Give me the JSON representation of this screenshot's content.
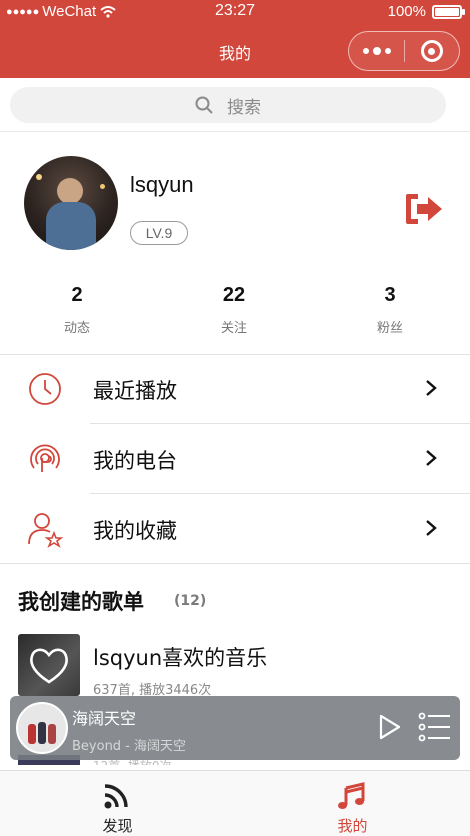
{
  "status_bar": {
    "carrier": "WeChat",
    "time": "23:27",
    "battery": "100%",
    "battery_level": 1.0
  },
  "nav": {
    "title": "我的"
  },
  "search": {
    "placeholder": "搜索"
  },
  "profile": {
    "username": "lsqyun",
    "level": "LV.9"
  },
  "stats": [
    {
      "value": "2",
      "label": "动态"
    },
    {
      "value": "22",
      "label": "关注"
    },
    {
      "value": "3",
      "label": "粉丝"
    }
  ],
  "menu": [
    {
      "label": "最近播放",
      "icon": "clock-icon"
    },
    {
      "label": "我的电台",
      "icon": "radio-icon"
    },
    {
      "label": "我的收藏",
      "icon": "user-star-icon"
    }
  ],
  "playlists_section": {
    "title": "我创建的歌单",
    "count": "(12)",
    "items": [
      {
        "name": "lsqyun喜欢的音乐",
        "meta": "637首, 播放3446次"
      },
      {
        "name": "",
        "meta": "12首, 播放0次"
      }
    ]
  },
  "player": {
    "song": "海阔天空",
    "artist": "Beyond - 海阔天空"
  },
  "tabbar": [
    {
      "label": "发现",
      "icon": "rss-icon"
    },
    {
      "label": "我的",
      "icon": "music-note-icon"
    }
  ],
  "colors": {
    "brand": "#d2473c",
    "tab_active": "#d2473c",
    "tab_inactive": "#222222"
  }
}
